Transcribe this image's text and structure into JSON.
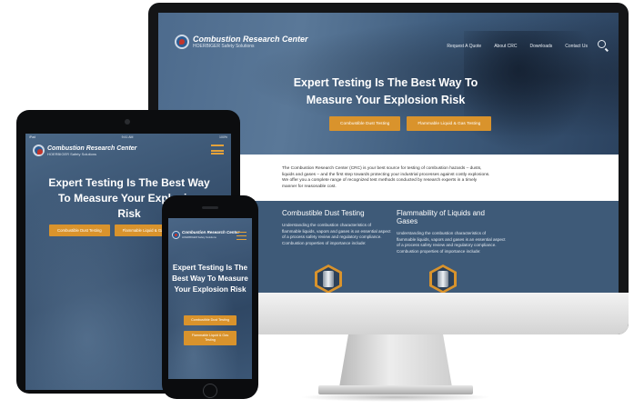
{
  "desktop": {
    "logo": {
      "title": "Combustion Research Center",
      "subtitle": "HOERBIGER Safety Solutions"
    },
    "nav": [
      "Request A Quote",
      "About CRC",
      "Downloads",
      "Contact Us"
    ],
    "hero": {
      "headline": "Expert Testing Is The Best Way To Measure Your Explosion Risk",
      "buttons": [
        "Combustible Dust Testing",
        "Flammable Liquid & Gas Testing"
      ]
    },
    "intro": "The Combustion Research Center (CRC) is your best source for testing of combustion hazards – dusts, liquids and gases – and the first step towards protecting your industrial processes against costly explosions. We offer you a complete range of recognized test methods conducted by research experts in a timely manner for reasonable cost.",
    "columns": [
      {
        "title": "Combustible Dust Testing",
        "text": "Understanding the combustion characteristics of flammable liquids, vapors and gases is an essential aspect of a process safety review and regulatory compliance. Combustion properties of importance include:"
      },
      {
        "title": "Flammability of Liquids and Gases",
        "text": "Understanding the combustion characteristics of flammable liquids, vapors and gases is an essential aspect of a process safety review and regulatory compliance. Combustion properties of importance include:"
      }
    ]
  },
  "tablet": {
    "status": {
      "left": "iPad",
      "time": "9:41 AM",
      "battery": "100%"
    },
    "logo": {
      "title": "Combustion Research Center",
      "subtitle": "HOERBIGER Safety Solutions"
    },
    "headline": "Expert Testing Is The Best Way To Measure Your Explosion Risk",
    "buttons": [
      "Combustible Dust Testing",
      "Flammable Liquid & Gas Testing"
    ]
  },
  "phone": {
    "logo": {
      "title": "Combustion Research Center",
      "subtitle": "HOERBIGER Safety Solutions"
    },
    "headline": "Expert Testing Is The Best Way To Measure Your Explosion Risk",
    "buttons": [
      "Combustible Dust Testing",
      "Flammable Liquid & Gas Testing"
    ]
  },
  "colors": {
    "accent": "#d9932c",
    "brand_blue": "#3e5a78",
    "logo_red": "#c2352b"
  },
  "icons": [
    "logo-mark-icon",
    "search-icon",
    "hamburger-menu-icon",
    "hexagon-equipment-icon"
  ]
}
